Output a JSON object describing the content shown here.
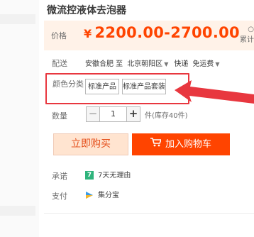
{
  "product": {
    "title": "微流控液体去泡器"
  },
  "price": {
    "label": "价格",
    "currency": "¥",
    "range": "2200.00-2700.00",
    "side_label": "累计"
  },
  "shipping": {
    "label": "配送",
    "origin": "安徽合肥 至",
    "destination": "北京朝阳区",
    "express": "快递",
    "fee": "免运费"
  },
  "sku": {
    "label": "颜色分类",
    "options": [
      "标准产品",
      "标准产品套装"
    ]
  },
  "quantity": {
    "label": "数量",
    "minus": "−",
    "value": "1",
    "plus": "+",
    "stock_text": "件(库存40件)"
  },
  "actions": {
    "buy_now": "立即购买",
    "add_to_cart": "加入购物车"
  },
  "services": {
    "promise_label": "承诺",
    "promise_text": "7天无理由",
    "promise_icon": "7",
    "pay_label": "支付",
    "pay_text": "集分宝"
  },
  "colors": {
    "accent": "#ff4400",
    "price": "#ff4400",
    "highlight": "#e8373f",
    "price_bg": "#fff2e8"
  }
}
